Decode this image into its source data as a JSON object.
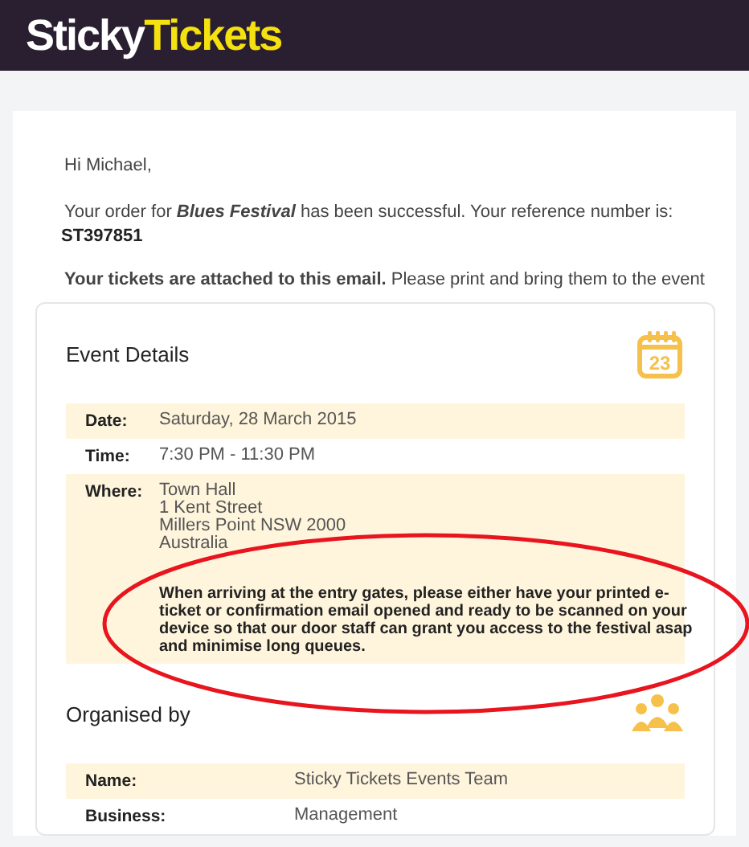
{
  "header": {
    "logo_part_1": "Sticky",
    "logo_part_2": "Tickets"
  },
  "greeting": "Hi Michael,",
  "order_message": "Your order for **Blues Festival** has been successful. Your reference number is:",
  "reference_number": "ST397851",
  "attachment_message": "**Your tickets are attached to this email.** Please print and bring them to the event",
  "event_details": {
    "title": "Event Details",
    "calendar_day": "23",
    "rows": [
      {
        "label": "Date:",
        "lines": [
          "Saturday, 28 March 2015"
        ]
      },
      {
        "label": "Time:",
        "lines": [
          "7:30 PM - 11:30 PM"
        ]
      },
      {
        "label": "Where:",
        "lines": [
          "Town Hall",
          "1 Kent Street",
          "Millers Point NSW 2000",
          "Australia"
        ],
        "note": "When arriving at the entry gates, please either have your printed e-ticket or confirmation email opened and ready to be scanned on your device so that our door staff can grant you access to the festival asap and minimise long queues."
      }
    ]
  },
  "organiser": {
    "title": "Organised by",
    "rows": [
      {
        "label": "Name:",
        "value": "Sticky Tickets Events Team"
      },
      {
        "label": "Business:",
        "value": "Management"
      }
    ]
  }
}
